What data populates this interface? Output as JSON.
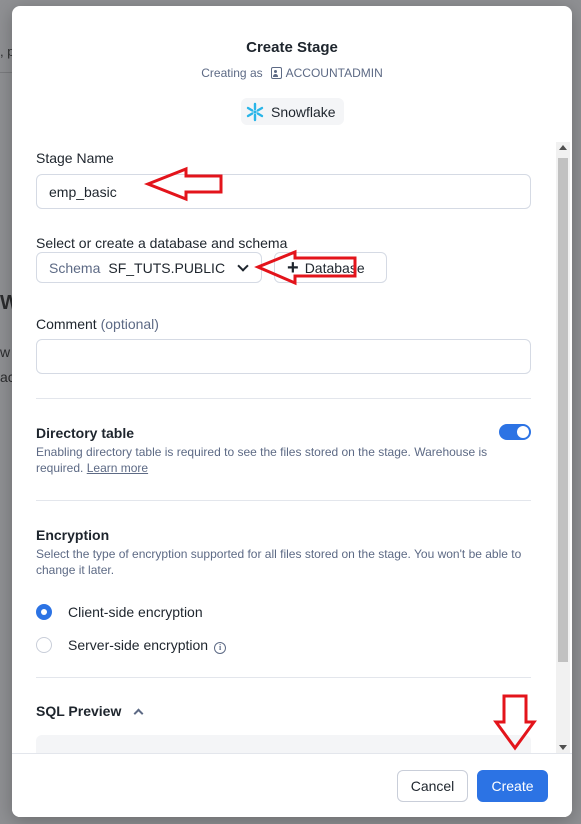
{
  "background": {
    "fragment_top": ", p",
    "fragment_mid": "W",
    "fragment_line1": "w",
    "fragment_line2": "ac"
  },
  "dialog": {
    "title": "Create Stage",
    "creating_as_label": "Creating as",
    "role": "ACCOUNTADMIN",
    "account": "Snowflake"
  },
  "form": {
    "stage_name": {
      "label": "Stage Name",
      "value": "emp_basic"
    },
    "database_schema": {
      "label": "Select or create a database and schema",
      "schema_label": "Schema",
      "schema_value": "SF_TUTS.PUBLIC",
      "add_database_label": "Database"
    },
    "comment": {
      "label": "Comment",
      "optional_label": "(optional)",
      "value": ""
    },
    "directory_table": {
      "title": "Directory table",
      "help": "Enabling directory table is required to see the files stored on the stage. Warehouse is required.",
      "learn_more": "Learn more",
      "enabled": true
    },
    "encryption": {
      "title": "Encryption",
      "help": "Select the type of encryption supported for all files stored on the stage. You won't be able to change it later.",
      "options": [
        {
          "label": "Client-side encryption",
          "selected": true
        },
        {
          "label": "Server-side encryption",
          "selected": false
        }
      ]
    },
    "sql_preview": {
      "title": "SQL Preview"
    }
  },
  "footer": {
    "cancel_label": "Cancel",
    "create_label": "Create"
  },
  "colors": {
    "accent": "#2c73e4",
    "annotation": "#e3141b",
    "snowflake": "#29b5e8"
  }
}
